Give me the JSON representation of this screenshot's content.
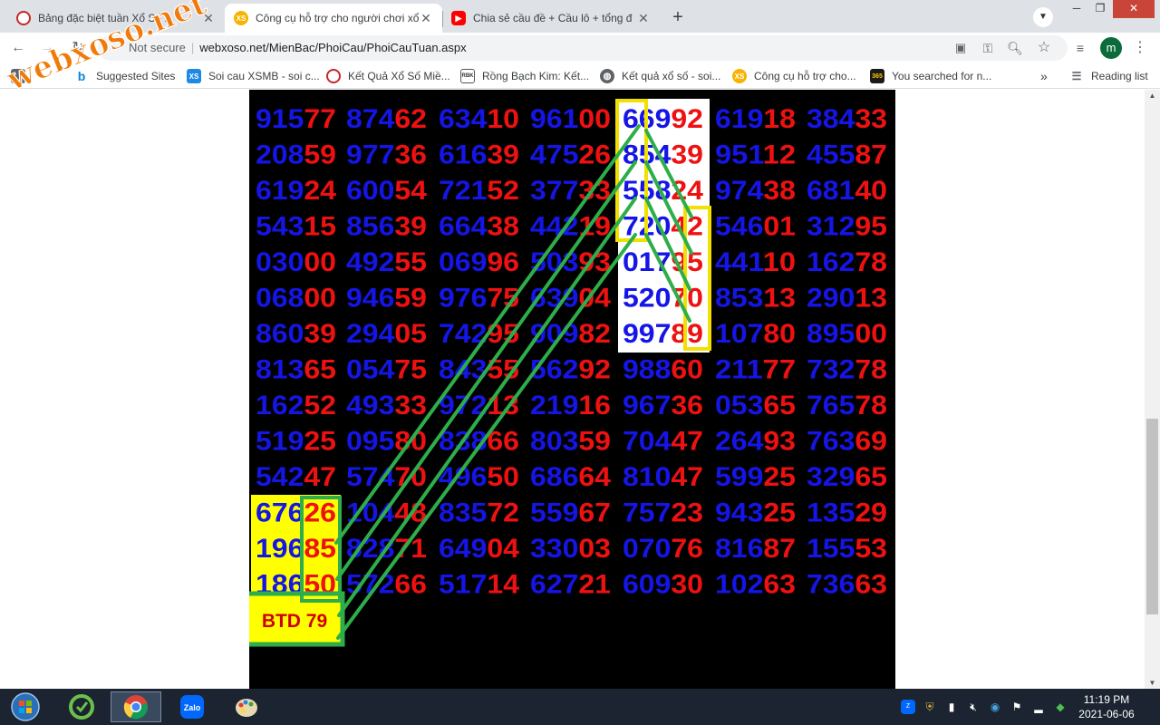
{
  "tabs": [
    {
      "title": "Bảng đặc biệt tuần Xổ Số ...",
      "active": false
    },
    {
      "title": "Công cụ hỗ trợ cho người chơi xổ",
      "active": true
    },
    {
      "title": "Chia sẻ cầu đề + Cầu lô + tổng đ",
      "active": false
    }
  ],
  "address": {
    "security": "Not secure",
    "url": "webxoso.net/MienBac/PhoiCau/PhoiCauTuan.aspx"
  },
  "profile_initial": "m",
  "bookmarks": [
    {
      "label": "Suggested Sites",
      "icon": "bing-icon"
    },
    {
      "label": "Soi cau XSMB - soi c...",
      "icon": "xs-icon"
    },
    {
      "label": "Kết Quả Xổ Số Miề...",
      "icon": "lottery-icon"
    },
    {
      "label": "Rồng Bạch Kim: Kết...",
      "icon": "rbk-icon"
    },
    {
      "label": "Kết quả xổ số - soi...",
      "icon": "globe-icon"
    },
    {
      "label": "Công cụ hỗ trợ cho...",
      "icon": "xs-icon"
    },
    {
      "label": "You searched for n...",
      "icon": "365-icon"
    }
  ],
  "bookmarks_more": "»",
  "reading_list": "Reading list",
  "watermark": "webxoso.net",
  "grid": {
    "rows": [
      [
        "91577",
        "87462",
        "63410",
        "96100",
        "66992",
        "61918",
        "38433"
      ],
      [
        "20859",
        "97736",
        "61639",
        "47526",
        "85439",
        "95112",
        "45587"
      ],
      [
        "61924",
        "60054",
        "72152",
        "37733",
        "55824",
        "97438",
        "68140"
      ],
      [
        "54315",
        "85639",
        "66438",
        "44219",
        "72042",
        "54601",
        "31295"
      ],
      [
        "03000",
        "49255",
        "06996",
        "50393",
        "01795",
        "44110",
        "16278"
      ],
      [
        "06800",
        "94659",
        "97675",
        "63904",
        "52070",
        "85313",
        "29013"
      ],
      [
        "86039",
        "29405",
        "74295",
        "90982",
        "99789",
        "10780",
        "89500"
      ],
      [
        "81365",
        "05475",
        "84355",
        "56292",
        "98860",
        "21177",
        "73278"
      ],
      [
        "16252",
        "49333",
        "97213",
        "21916",
        "96736",
        "05365",
        "76578"
      ],
      [
        "51925",
        "09580",
        "83866",
        "80359",
        "70447",
        "26493",
        "76369"
      ],
      [
        "54247",
        "57470",
        "49650",
        "68664",
        "81047",
        "59925",
        "32965"
      ],
      [
        "67626",
        "10448",
        "83572",
        "55967",
        "75723",
        "94325",
        "13529"
      ],
      [
        "19685",
        "82871",
        "64904",
        "33003",
        "07076",
        "81687",
        "15553"
      ],
      [
        "18650",
        "57266",
        "51714",
        "62721",
        "60930",
        "10263",
        "73663"
      ]
    ]
  },
  "result_label": "BTD 79",
  "colors": {
    "blue": "#1515e6",
    "red": "#ee1111",
    "yellow": "#ffff00",
    "green": "#2eae4a",
    "bg": "#000000"
  },
  "clock": {
    "time": "11:19 PM",
    "date": "2021-06-06"
  },
  "taskbar_apps": [
    "start-orb-icon",
    "ccleaner-icon",
    "chrome-icon",
    "zalo-icon",
    "paint-icon"
  ]
}
